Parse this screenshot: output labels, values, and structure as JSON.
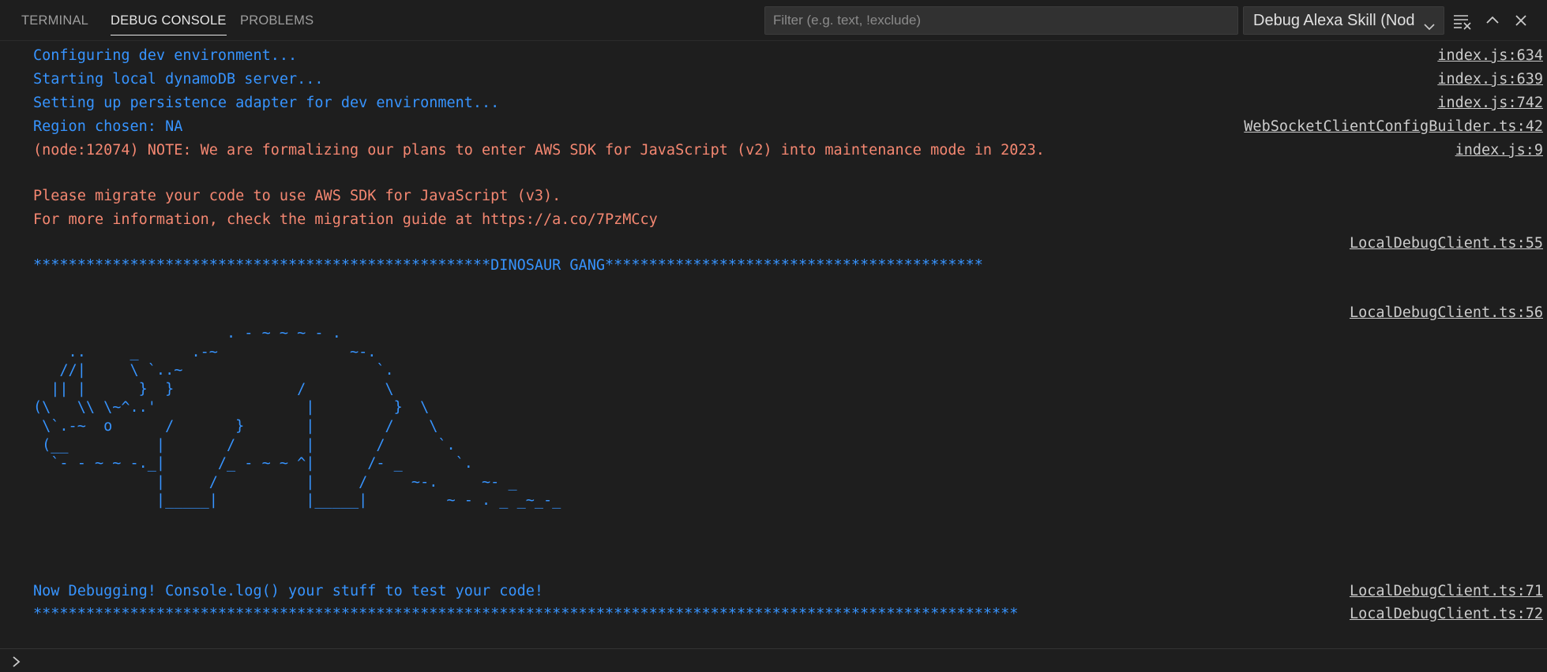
{
  "tabs": [
    {
      "label": "TERMINAL",
      "active": false
    },
    {
      "label": "DEBUG CONSOLE",
      "active": true
    },
    {
      "label": "PROBLEMS",
      "active": false
    }
  ],
  "filter": {
    "placeholder": "Filter (e.g. text, !exclude)",
    "value": ""
  },
  "session": {
    "selected": "Debug Alexa Skill (Node"
  },
  "icons": {
    "clear": "clear-all-icon",
    "maximize": "chevron-up-icon",
    "close": "close-icon",
    "dropdown": "chevron-down-icon",
    "prompt": "chevron-right-icon"
  },
  "colors": {
    "background": "#1e1e1e",
    "log_blue": "#3794ff",
    "warn_orange": "#f48771",
    "source_link": "#cccccc"
  },
  "console": {
    "lines": [
      {
        "text": "Configuring dev environment...",
        "color": "blue",
        "source": "index.js:634"
      },
      {
        "text": "Starting local dynamoDB server...",
        "color": "blue",
        "source": "index.js:639"
      },
      {
        "text": "Setting up persistence adapter for dev environment...",
        "color": "blue",
        "source": "index.js:742"
      },
      {
        "text": "Region chosen: NA",
        "color": "blue",
        "source": "WebSocketClientConfigBuilder.ts:42"
      },
      {
        "text": "(node:12074) NOTE: We are formalizing our plans to enter AWS SDK for JavaScript (v2) into maintenance mode in 2023.",
        "color": "orange",
        "source": "index.js:9"
      },
      {
        "text": "Please migrate your code to use AWS SDK for JavaScript (v3).",
        "color": "orange",
        "source": ""
      },
      {
        "text": "For more information, check the migration guide at https://a.co/7PzMCcy",
        "color": "orange",
        "source": ""
      },
      {
        "text": "",
        "color": "blue",
        "source": "LocalDebugClient.ts:55"
      },
      {
        "text": "****************************************************DINOSAUR GANG*******************************************",
        "color": "blue",
        "source": ""
      },
      {
        "text": "",
        "color": "blue",
        "source": "LocalDebugClient.ts:56"
      },
      {
        "text": "Now Debugging! Console.log() your stuff to test your code!",
        "color": "blue",
        "source": "LocalDebugClient.ts:71"
      },
      {
        "text": "****************************************************************************************************************",
        "color": "blue",
        "source": "LocalDebugClient.ts:72"
      }
    ],
    "ascii_art": "                      . - ~ ~ ~ - .\n    ..     _      .-~               ~-.\n   //|     \\ `..~                      `.\n  || |      }  }              /         \\\n(\\   \\\\ \\~^..'                 |         }  \\\n \\`.-~  o      /       }       |        /    \\\n (__          |       /        |       /      `.\n  `- - ~ ~ -._|      /_ - ~ ~ ^|      /- _      `.\n              |     /          |     /     ~-.     ~- _\n              |_____|          |_____|         ~ - . _ _~_-_"
  },
  "repl": {
    "value": ""
  }
}
